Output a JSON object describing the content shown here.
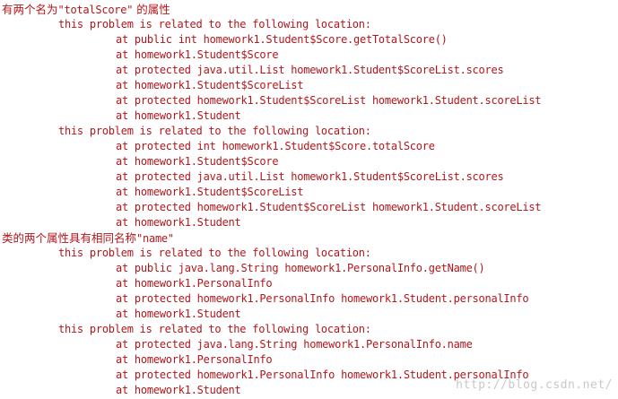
{
  "console": {
    "blocks": [
      {
        "heading": {
          "prefix": "有两个名为",
          "name": "\"totalScore\"",
          "suffix": " 的属性"
        },
        "problems": [
          {
            "label": "this problem is related to the following location:",
            "frames": [
              "at public int homework1.Student$Score.getTotalScore()",
              "at homework1.Student$Score",
              "at protected java.util.List homework1.Student$ScoreList.scores",
              "at homework1.Student$ScoreList",
              "at protected homework1.Student$ScoreList homework1.Student.scoreList",
              "at homework1.Student"
            ]
          },
          {
            "label": "this problem is related to the following location:",
            "frames": [
              "at protected int homework1.Student$Score.totalScore",
              "at homework1.Student$Score",
              "at protected java.util.List homework1.Student$ScoreList.scores",
              "at homework1.Student$ScoreList",
              "at protected homework1.Student$ScoreList homework1.Student.scoreList",
              "at homework1.Student"
            ]
          }
        ]
      },
      {
        "heading": {
          "prefix": "类的两个属性具有相同名称",
          "name": "\"name\"",
          "suffix": ""
        },
        "problems": [
          {
            "label": "this problem is related to the following location:",
            "frames": [
              "at public java.lang.String homework1.PersonalInfo.getName()",
              "at homework1.PersonalInfo",
              "at protected homework1.PersonalInfo homework1.Student.personalInfo",
              "at homework1.Student"
            ]
          },
          {
            "label": "this problem is related to the following location:",
            "frames": [
              "at protected java.lang.String homework1.PersonalInfo.name",
              "at homework1.PersonalInfo",
              "at protected homework1.PersonalInfo homework1.Student.personalInfo",
              "at homework1.Student"
            ]
          }
        ]
      }
    ]
  },
  "watermark": "http://blog.csdn.net/",
  "colors": {
    "text": "#b3161b",
    "background": "#ffffff",
    "watermark": "#c8c8c8"
  }
}
